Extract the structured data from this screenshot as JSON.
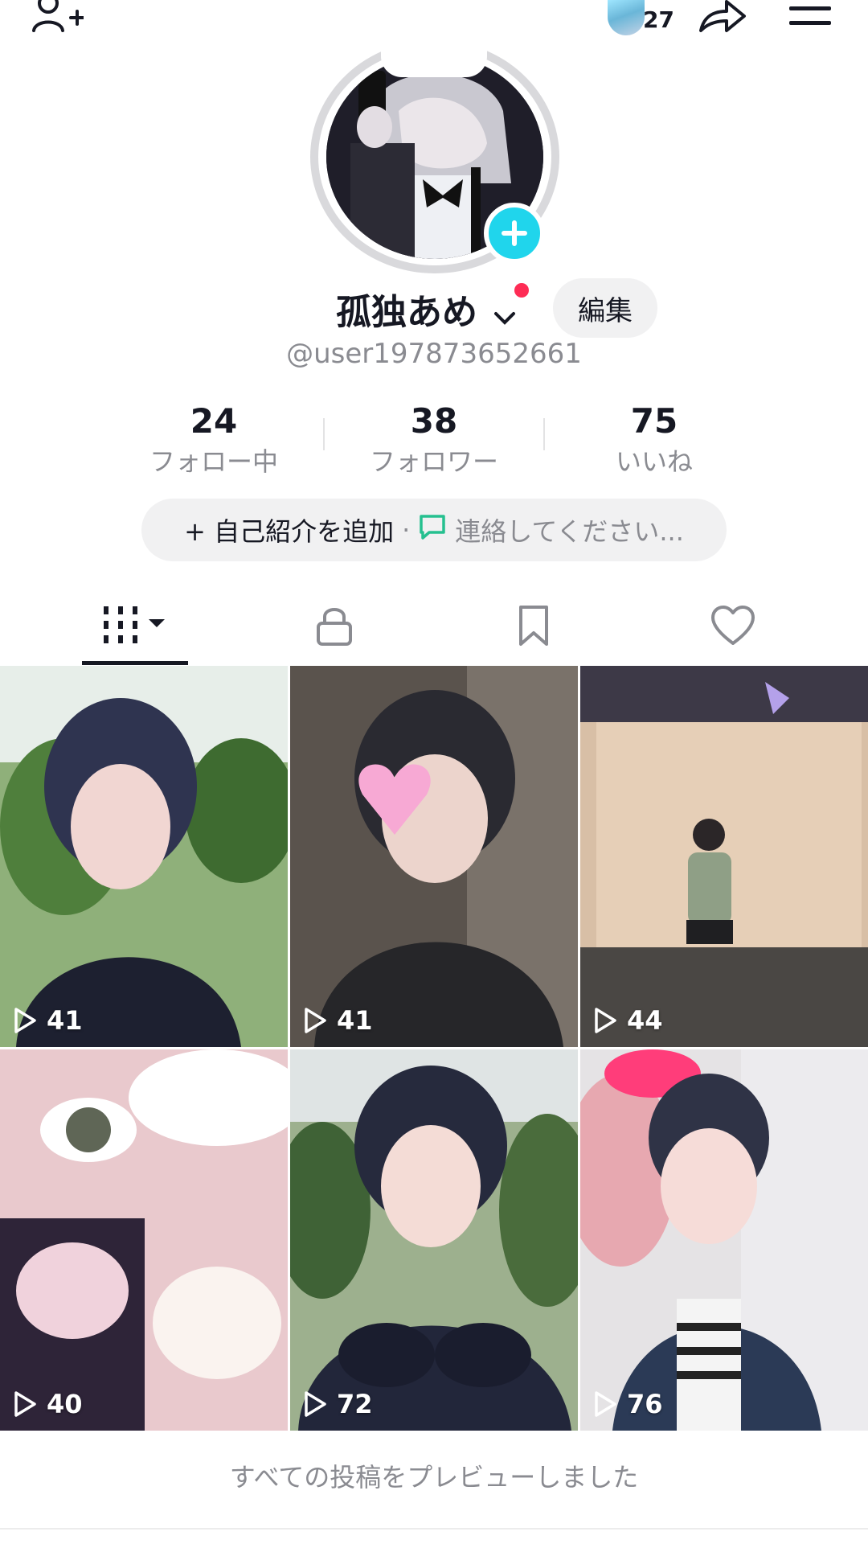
{
  "header": {
    "story_count": "27",
    "icons": [
      "add-friend-icon",
      "share-icon",
      "menu-icon"
    ]
  },
  "profile": {
    "display_name": "孤独あめ",
    "handle": "@user197873652661",
    "edit_label": "編集"
  },
  "stats": [
    {
      "value": "24",
      "label": "フォロー中"
    },
    {
      "value": "38",
      "label": "フォロワー"
    },
    {
      "value": "75",
      "label": "いいね"
    }
  ],
  "bio": {
    "add_label": "+ 自己紹介を追加",
    "separator": "·",
    "contact_label": "連絡してください..."
  },
  "tabs": [
    "videos-grid",
    "private-lock",
    "favorites-bookmark",
    "liked-heart"
  ],
  "videos": [
    {
      "views": "41"
    },
    {
      "views": "41"
    },
    {
      "views": "44"
    },
    {
      "views": "40"
    },
    {
      "views": "72"
    },
    {
      "views": "76"
    }
  ],
  "footer": {
    "text": "すべての投稿をプレビューしました"
  },
  "colors": {
    "accent_cyan": "#20d5ec",
    "notify_red": "#fe2c55",
    "text_primary": "#161823",
    "text_secondary": "#8a8b91",
    "chip_bg": "#f1f1f2"
  }
}
